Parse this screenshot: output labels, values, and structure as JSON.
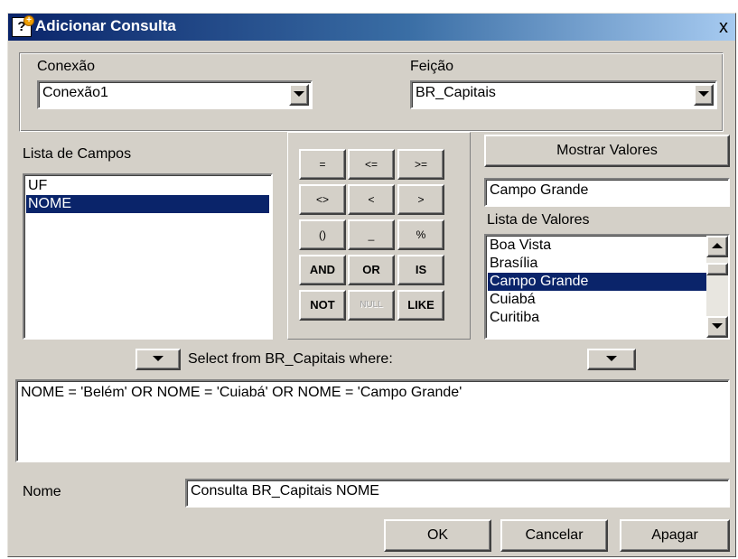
{
  "window": {
    "title": "Adicionar Consulta",
    "close_symbol": "x"
  },
  "connection": {
    "label": "Conexão",
    "value": "Conexão1"
  },
  "feature": {
    "label": "Feição",
    "value": "BR_Capitais"
  },
  "fields": {
    "label": "Lista de Campos",
    "items": [
      "UF",
      "NOME"
    ],
    "selected_index": 1
  },
  "operators": {
    "row1": [
      "=",
      "<=",
      ">="
    ],
    "row2": [
      "<>",
      "<",
      ">"
    ],
    "row3": [
      "()",
      "_",
      "%"
    ],
    "row4": [
      "AND",
      "OR",
      "IS"
    ],
    "row5": [
      "NOT",
      "NULL",
      "LIKE"
    ]
  },
  "values": {
    "show_button": "Mostrar Valores",
    "current_value": "Campo Grande",
    "list_label": "Lista de Valores",
    "items": [
      "Boa Vista",
      "Brasília",
      "Campo Grande",
      "Cuiabá",
      "Curitiba"
    ],
    "selected_index": 2
  },
  "query": {
    "select_label": "Select from BR_Capitais where:",
    "text": "NOME = 'Belém' OR NOME = 'Cuiabá' OR NOME = 'Campo Grande'"
  },
  "name": {
    "label": "Nome",
    "value": "Consulta BR_Capitais NOME"
  },
  "buttons": {
    "ok": "OK",
    "cancel": "Cancelar",
    "clear": "Apagar"
  }
}
